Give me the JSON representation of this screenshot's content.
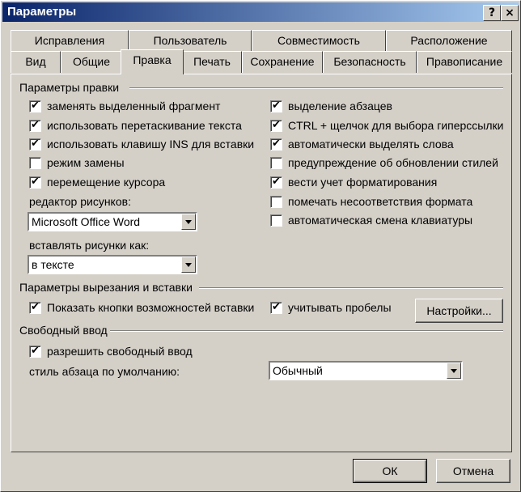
{
  "window": {
    "title": "Параметры",
    "help_button": "?",
    "close_button": "×"
  },
  "tabs_back": [
    "Исправления",
    "Пользователь",
    "Совместимость",
    "Расположение"
  ],
  "tabs_front": [
    "Вид",
    "Общие",
    "Правка",
    "Печать",
    "Сохранение",
    "Безопасность",
    "Правописание"
  ],
  "active_tab": "Правка",
  "edit_group": {
    "title": "Параметры правки",
    "left": [
      {
        "label": "заменять выделенный фрагмент",
        "checked": true
      },
      {
        "label": "использовать перетаскивание текста",
        "checked": true
      },
      {
        "label": "использовать клавишу INS для вставки",
        "checked": true
      },
      {
        "label": "режим замены",
        "checked": false
      },
      {
        "label": "перемещение курсора",
        "checked": true
      }
    ],
    "right": [
      {
        "label": "выделение абзацев",
        "checked": true
      },
      {
        "label": "CTRL + щелчок для выбора гиперссылки",
        "checked": true
      },
      {
        "label": "автоматически выделять слова",
        "checked": true
      },
      {
        "label": "предупреждение об обновлении стилей",
        "checked": false
      },
      {
        "label": "вести учет форматирования",
        "checked": true
      },
      {
        "label": "помечать несоответствия формата",
        "checked": false
      },
      {
        "label": "автоматическая смена клавиатуры",
        "checked": false
      }
    ],
    "picture_editor_label": "редактор рисунков:",
    "picture_editor_value": "Microsoft Office Word",
    "insert_pictures_label": "вставлять рисунки как:",
    "insert_pictures_value": "в тексте"
  },
  "cut_paste_group": {
    "title": "Параметры вырезания и вставки",
    "show_paste_options": {
      "label": "Показать кнопки возможностей вставки",
      "checked": true
    },
    "smart_spacing": {
      "label": "учитывать пробелы",
      "checked": true
    },
    "settings_button": "Настройки..."
  },
  "free_input_group": {
    "title": "Свободный ввод",
    "enable": {
      "label": "разрешить свободный ввод",
      "checked": true
    },
    "default_style_label": "стиль абзаца по умолчанию:",
    "default_style_value": "Обычный"
  },
  "buttons": {
    "ok": "ОК",
    "cancel": "Отмена"
  }
}
